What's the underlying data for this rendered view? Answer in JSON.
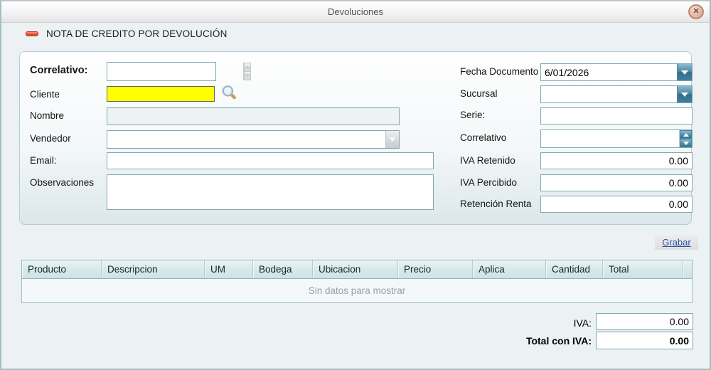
{
  "window": {
    "title": "Devoluciones"
  },
  "header": {
    "title": "NOTA DE CREDITO POR DEVOLUCIÓN"
  },
  "form": {
    "left": {
      "correlativo_label": "Correlativo:",
      "correlativo_value": "",
      "cliente_label": "Cliente",
      "cliente_value": "",
      "nombre_label": "Nombre",
      "nombre_value": "",
      "vendedor_label": "Vendedor",
      "vendedor_value": "",
      "email_label": "Email:",
      "email_value": "",
      "observaciones_label": "Observaciones",
      "observaciones_value": ""
    },
    "right": {
      "fecha_label": "Fecha Documento",
      "fecha_value": "6/01/2026",
      "sucursal_label": "Sucursal",
      "sucursal_value": "",
      "serie_label": "Serie:",
      "serie_value": "",
      "correlativo_label": "Correlativo",
      "correlativo_value": "",
      "iva_retenido_label": "IVA Retenido",
      "iva_retenido_value": "0.00",
      "iva_percibido_label": "IVA Percibido",
      "iva_percibido_value": "0.00",
      "retencion_label": "Retención Renta",
      "retencion_value": "0.00"
    }
  },
  "actions": {
    "grabar_label": "Grabar"
  },
  "grid": {
    "columns": [
      "Producto",
      "Descripcion",
      "UM",
      "Bodega",
      "Ubicacion",
      "Precio",
      "Aplica",
      "Cantidad",
      "Total",
      ""
    ],
    "empty_text": "Sin datos para mostrar"
  },
  "totals": {
    "iva_label": "IVA:",
    "iva_value": "0.00",
    "total_label": "Total con IVA:",
    "total_value": "0.00"
  },
  "colors": {
    "accent_teal": "#2f6f8f",
    "field_border": "#7fa8af",
    "highlight_yellow": "#ffff00",
    "close_red": "#d79f87"
  }
}
